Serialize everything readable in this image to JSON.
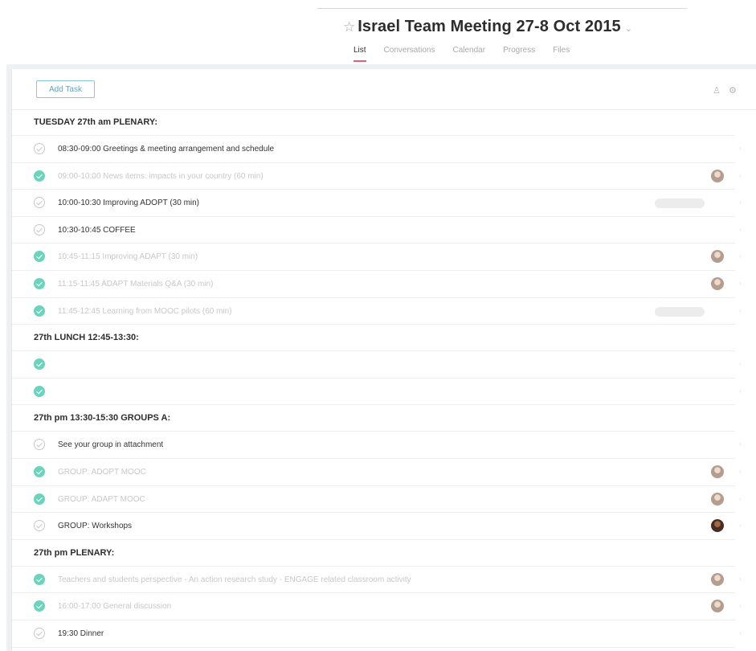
{
  "project": {
    "title": "Israel Team Meeting 27-8 Oct 2015"
  },
  "tabs": [
    "List",
    "Conversations",
    "Calendar",
    "Progress",
    "Files"
  ],
  "toolbar": {
    "add_task_label": "Add Task"
  },
  "sections": [
    {
      "title": "TUESDAY 27th am PLENARY:",
      "tasks": [
        {
          "text": "08:30-09:00 Greetings & meeting arrangement and schedule",
          "done": false,
          "avatar": false,
          "tag": false
        },
        {
          "text": "09:00-10:00 News items: impacts in your country (60 min)",
          "done": true,
          "avatar": true,
          "tag": false
        },
        {
          "text": "10:00-10:30 Improving ADOPT  (30 min)",
          "done": false,
          "avatar": false,
          "tag": true
        },
        {
          "text": "10:30-10:45 COFFEE",
          "done": false,
          "avatar": false,
          "tag": false
        },
        {
          "text": "10:45-11:15 Improving ADAPT  (30 min)",
          "done": true,
          "avatar": true,
          "tag": false
        },
        {
          "text": "11:15-11:45 ADAPT Materials Q&A  (30 min)",
          "done": true,
          "avatar": true,
          "tag": false
        },
        {
          "text": "11:45-12:45 Learning from MOOC pilots (60 min)",
          "done": true,
          "avatar": false,
          "tag": true
        }
      ]
    },
    {
      "title": "27th LUNCH 12:45-13:30:",
      "tasks": [
        {
          "text": "",
          "done": true,
          "avatar": false,
          "tag": false
        },
        {
          "text": "",
          "done": true,
          "avatar": false,
          "tag": false
        }
      ]
    },
    {
      "title": "27th pm 13:30-15:30 GROUPS A:",
      "tasks": [
        {
          "text": "See your group in attachment",
          "done": false,
          "avatar": false,
          "tag": false
        },
        {
          "text": "GROUP: ADOPT MOOC",
          "done": true,
          "avatar": true,
          "tag": false
        },
        {
          "text": "GROUP: ADAPT MOOC",
          "done": true,
          "avatar": true,
          "tag": false
        },
        {
          "text": "GROUP: Workshops",
          "done": false,
          "avatar": true,
          "avatar_dark": true,
          "tag": false
        }
      ]
    },
    {
      "title": "27th pm PLENARY:",
      "tasks": [
        {
          "text": "Teachers and students perspective - An action research study - ENGAGE related classroom activity",
          "done": true,
          "avatar": true,
          "tag": false
        },
        {
          "text": "16:00-17:00 General discussion",
          "done": true,
          "avatar": true,
          "tag": false
        },
        {
          "text": "19:30 Dinner",
          "done": false,
          "avatar": false,
          "tag": false
        }
      ]
    }
  ],
  "icons": {
    "favorite": "star-icon",
    "title_menu": "chevron-down-icon",
    "assignee_filter": "person-icon",
    "settings": "gear-icon"
  },
  "colors": {
    "accent_tab": "#e0607c",
    "done_check": "#6dd3bd",
    "add_task_border": "#88c6d8"
  }
}
